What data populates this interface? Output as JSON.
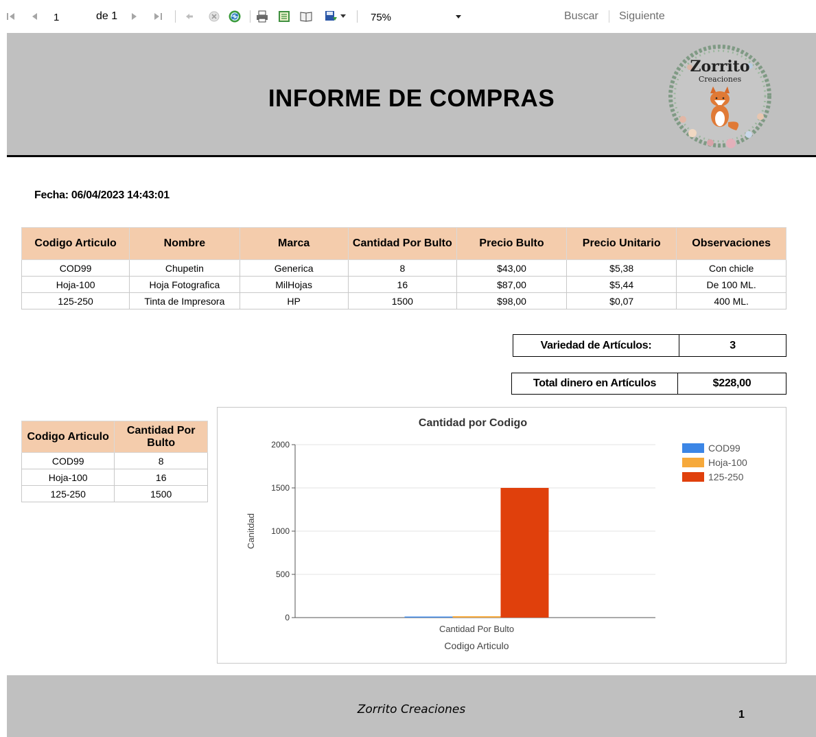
{
  "toolbar": {
    "page_current": "1",
    "page_of_label": "de 1",
    "zoom_value": "75%",
    "find_placeholder": "",
    "find_label": "Buscar",
    "next_label": "Siguiente"
  },
  "report": {
    "title": "INFORME DE  COMPRAS",
    "logo_text_main": "Zorrito",
    "logo_text_sub": "Creaciones",
    "fecha": "Fecha: 06/04/2023 14:43:01",
    "main_table": {
      "headers": [
        "Codigo Articulo",
        "Nombre",
        "Marca",
        "Cantidad Por Bulto",
        "Precio Bulto",
        "Precio Unitario",
        "Observaciones"
      ],
      "rows": [
        [
          "COD99",
          "Chupetin",
          "Generica",
          "8",
          "$43,00",
          "$5,38",
          "Con chicle"
        ],
        [
          "Hoja-100",
          "Hoja Fotografica",
          "MilHojas",
          "16",
          "$87,00",
          "$5,44",
          "De 100 ML."
        ],
        [
          "125-250",
          "Tinta de Impresora",
          "HP",
          "1500",
          "$98,00",
          "$0,07",
          "400 ML."
        ]
      ]
    },
    "summary": {
      "variedad_label": "Variedad de Artículos:",
      "variedad_value": "3",
      "total_label": "Total dinero en Artículos",
      "total_value": "$228,00"
    },
    "small_table": {
      "headers": [
        "Codigo Articulo",
        "Cantidad Por Bulto"
      ],
      "rows": [
        [
          "COD99",
          "8"
        ],
        [
          "Hoja-100",
          "16"
        ],
        [
          "125-250",
          "1500"
        ]
      ]
    },
    "footer_text": "Zorrito Creaciones",
    "page_number": "1"
  },
  "colors": {
    "header_bg": "#c0c0c0",
    "table_header_bg": "#f4ccac",
    "series_cod99": "#3c86e6",
    "series_hoja100": "#f6a93b",
    "series_125250": "#e0400c"
  },
  "chart_data": {
    "type": "bar",
    "title": "Cantidad por Codigo",
    "xlabel": "Codigo Articulo",
    "ylabel": "Canitdad",
    "categories": [
      "Cantidad Por Bulto"
    ],
    "series": [
      {
        "name": "COD99",
        "values": [
          8
        ]
      },
      {
        "name": "Hoja-100",
        "values": [
          16
        ]
      },
      {
        "name": "125-250",
        "values": [
          1500
        ]
      }
    ],
    "ylim": [
      0,
      2000
    ],
    "yticks": [
      0,
      500,
      1000,
      1500,
      2000
    ],
    "grid": true,
    "legend": "top-right"
  }
}
